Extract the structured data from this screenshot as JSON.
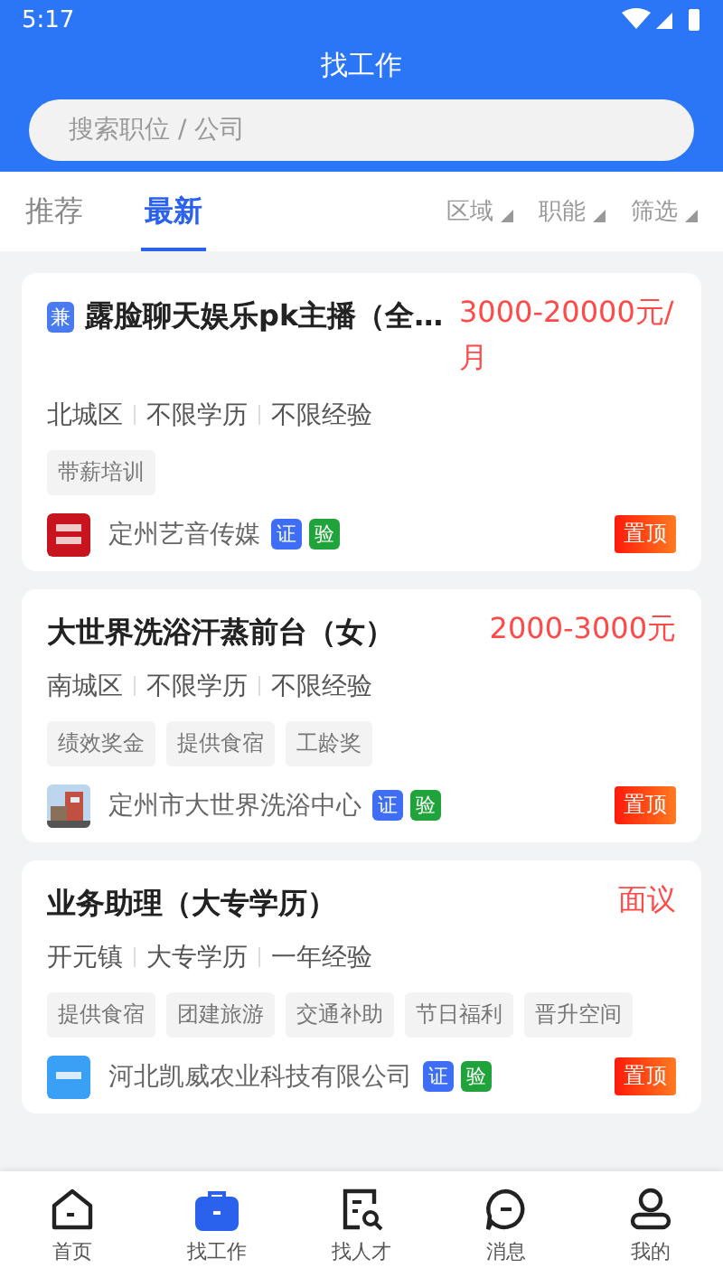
{
  "status_bar": {
    "time": "5:17"
  },
  "header": {
    "title": "找工作"
  },
  "search": {
    "placeholder": "搜索职位 / 公司"
  },
  "tabs": [
    {
      "label": "推荐",
      "selected": false
    },
    {
      "label": "最新",
      "selected": true
    }
  ],
  "filters": [
    {
      "label": "区域"
    },
    {
      "label": "职能"
    },
    {
      "label": "筛选"
    }
  ],
  "jobs": [
    {
      "type_badge": "兼",
      "title": "露脸聊天娱乐pk主播（全…",
      "salary": "3000-20000元/月",
      "meta": [
        "北城区",
        "不限学历",
        "不限经验"
      ],
      "perks": [
        "带薪培训"
      ],
      "company": "定州艺音传媒",
      "badges": [
        {
          "label": "证",
          "kind": "cert"
        },
        {
          "label": "验",
          "kind": "verified"
        }
      ],
      "pin": "置顶"
    },
    {
      "title": "大世界洗浴汗蒸前台（女）",
      "salary": "2000-3000元",
      "meta": [
        "南城区",
        "不限学历",
        "不限经验"
      ],
      "perks": [
        "绩效奖金",
        "提供食宿",
        "工龄奖"
      ],
      "company": "定州市大世界洗浴中心",
      "badges": [
        {
          "label": "证",
          "kind": "cert"
        },
        {
          "label": "验",
          "kind": "verified"
        }
      ],
      "pin": "置顶"
    },
    {
      "title": "业务助理（大专学历）",
      "salary": "面议",
      "meta": [
        "开元镇",
        "大专学历",
        "一年经验"
      ],
      "perks": [
        "提供食宿",
        "团建旅游",
        "交通补助",
        "节日福利",
        "晋升空间"
      ],
      "company": "河北凯威农业科技有限公司",
      "badges": [
        {
          "label": "证",
          "kind": "cert"
        },
        {
          "label": "验",
          "kind": "verified"
        }
      ],
      "pin": "置顶"
    }
  ],
  "nav": [
    {
      "label": "首页",
      "selected": false
    },
    {
      "label": "找工作",
      "selected": true
    },
    {
      "label": "找人才",
      "selected": false
    },
    {
      "label": "消息",
      "selected": false
    },
    {
      "label": "我的",
      "selected": false
    }
  ]
}
